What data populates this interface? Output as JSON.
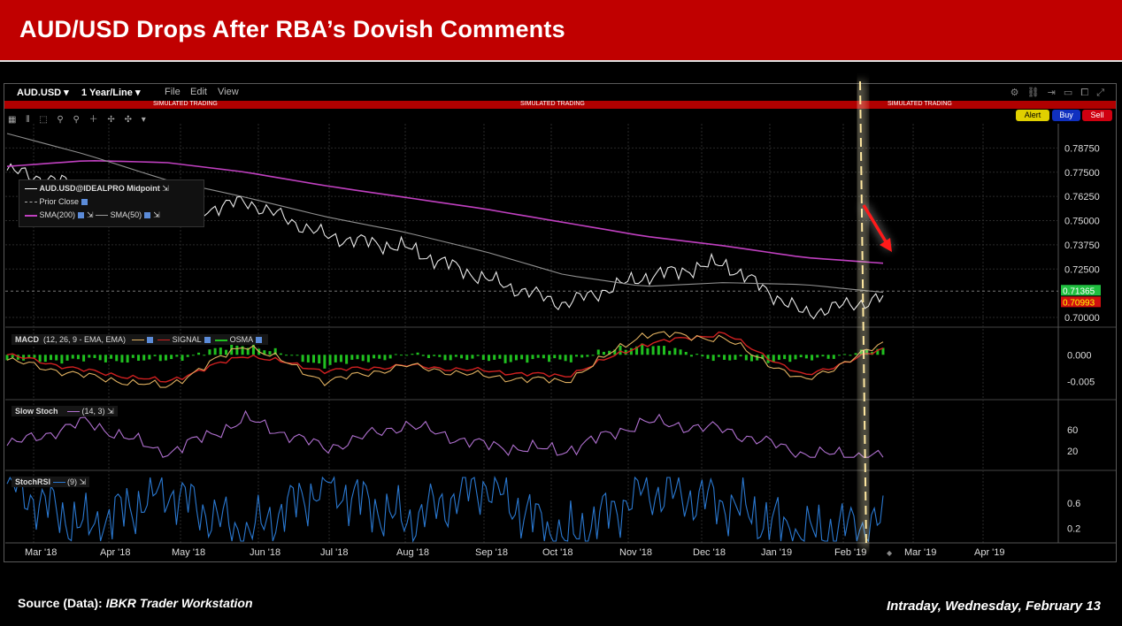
{
  "banner": {
    "title": "AUD/USD Drops After RBA’s Dovish Comments"
  },
  "toolbar": {
    "symbol": "AUD.USD ▾",
    "period": "1 Year/Line ▾",
    "menu_file": "File",
    "menu_edit": "Edit",
    "menu_view": "View",
    "sim_label": "SIMULATED TRADING",
    "alert": "Alert",
    "buy": "Buy",
    "sell": "Sell"
  },
  "legend": {
    "series1": "AUD.USD@IDEALPRO Midpoint",
    "prior_close": "Prior Close",
    "sma200": "SMA(200)",
    "sma50": "SMA(50)"
  },
  "panels": {
    "macd": {
      "name": "MACD",
      "params": "(12, 26, 9 - EMA, EMA)",
      "signal": "SIGNAL",
      "osma": "OSMA"
    },
    "stoch": {
      "name": "Slow Stoch",
      "params": "(14, 3)"
    },
    "stochrsi": {
      "name": "StochRSI",
      "params": "(9)"
    }
  },
  "footer": {
    "source_label": "Source (Data):",
    "source_value": "IBKR Trader Workstation",
    "date": "Intraday, Wednesday, February 13"
  },
  "colors": {
    "price": "#e8e8e8",
    "sma200": "#c040c0",
    "sma50": "#909090",
    "macd": "#e0b060",
    "signal": "#d02020",
    "osma": "#20c020",
    "stoch": "#b070d0",
    "stochrsi": "#2a78d0",
    "arrow": "#ff1a1a",
    "marker": "#ffe8a0"
  },
  "chart_data": [
    {
      "type": "line",
      "title": "AUD.USD 1 Year/Line",
      "x": [
        "Mar '18",
        "Apr '18",
        "May '18",
        "Jun '18",
        "Jul '18",
        "Aug '18",
        "Sep '18",
        "Oct '18",
        "Nov '18",
        "Dec '18",
        "Jan '19",
        "Feb '19"
      ],
      "x_axis_labels": [
        "Mar '18",
        "Apr '18",
        "May '18",
        "Jun '18",
        "Jul '18",
        "Aug '18",
        "Sep '18",
        "Oct '18",
        "Nov '18",
        "Dec '18",
        "Jan '19",
        "Feb '19",
        "Mar '19",
        "Apr '19"
      ],
      "series": [
        {
          "name": "AUD.USD@IDEALPRO Midpoint",
          "values": [
            0.776,
            0.767,
            0.752,
            0.76,
            0.742,
            0.736,
            0.72,
            0.707,
            0.721,
            0.728,
            0.702,
            0.7099
          ]
        },
        {
          "name": "SMA(200)",
          "values": [
            0.778,
            0.781,
            0.78,
            0.775,
            0.768,
            0.762,
            0.756,
            0.749,
            0.742,
            0.737,
            0.731,
            0.728
          ]
        },
        {
          "name": "SMA(50)",
          "values": [
            0.795,
            0.784,
            0.771,
            0.762,
            0.752,
            0.744,
            0.734,
            0.722,
            0.716,
            0.718,
            0.717,
            0.713
          ]
        }
      ],
      "y_ticks": [
        0.7875,
        0.775,
        0.7625,
        0.75,
        0.7375,
        0.725,
        0.7
      ],
      "price_labels": [
        "0.71365",
        "0.70993"
      ],
      "ylim": [
        0.695,
        0.8
      ]
    },
    {
      "type": "line",
      "title": "MACD (12, 26, 9 - EMA, EMA)",
      "x": [
        "Mar '18",
        "Apr '18",
        "May '18",
        "Jun '18",
        "Jul '18",
        "Aug '18",
        "Sep '18",
        "Oct '18",
        "Nov '18",
        "Dec '18",
        "Jan '19",
        "Feb '19"
      ],
      "series": [
        {
          "name": "MACD",
          "values": [
            -0.001,
            -0.004,
            -0.006,
            0.002,
            -0.005,
            -0.002,
            -0.004,
            -0.005,
            0.004,
            0.003,
            -0.005,
            0.002
          ]
        },
        {
          "name": "SIGNAL",
          "values": [
            0.0,
            -0.003,
            -0.005,
            0.0,
            -0.003,
            -0.002,
            -0.003,
            -0.004,
            0.002,
            0.004,
            -0.004,
            0.001
          ]
        },
        {
          "name": "OSMA",
          "values": [
            -0.001,
            -0.001,
            -0.001,
            0.002,
            -0.002,
            0.0,
            -0.001,
            -0.001,
            0.002,
            -0.001,
            -0.001,
            0.001
          ]
        }
      ],
      "y_ticks": [
        0.0,
        -0.005
      ]
    },
    {
      "type": "line",
      "title": "Slow Stoch (14, 3)",
      "x": [
        "Mar '18",
        "Apr '18",
        "May '18",
        "Jun '18",
        "Jul '18",
        "Aug '18",
        "Sep '18",
        "Oct '18",
        "Nov '18",
        "Dec '18",
        "Jan '19",
        "Feb '19"
      ],
      "series": [
        {
          "name": "Slow Stoch",
          "values": [
            30,
            75,
            15,
            80,
            25,
            70,
            30,
            20,
            75,
            60,
            15,
            10
          ]
        }
      ],
      "y_ticks": [
        60,
        20
      ]
    },
    {
      "type": "line",
      "title": "StochRSI (9)",
      "x": [
        "Mar '18",
        "Apr '18",
        "May '18",
        "Jun '18",
        "Jul '18",
        "Aug '18",
        "Sep '18",
        "Oct '18",
        "Nov '18",
        "Dec '18",
        "Jan '19",
        "Feb '19"
      ],
      "series": [
        {
          "name": "StochRSI",
          "values": [
            0.9,
            0.2,
            0.8,
            0.1,
            0.9,
            0.3,
            0.9,
            0.0,
            0.8,
            0.6,
            0.1,
            0.3
          ]
        }
      ],
      "y_ticks": [
        0.6,
        0.2
      ]
    }
  ]
}
